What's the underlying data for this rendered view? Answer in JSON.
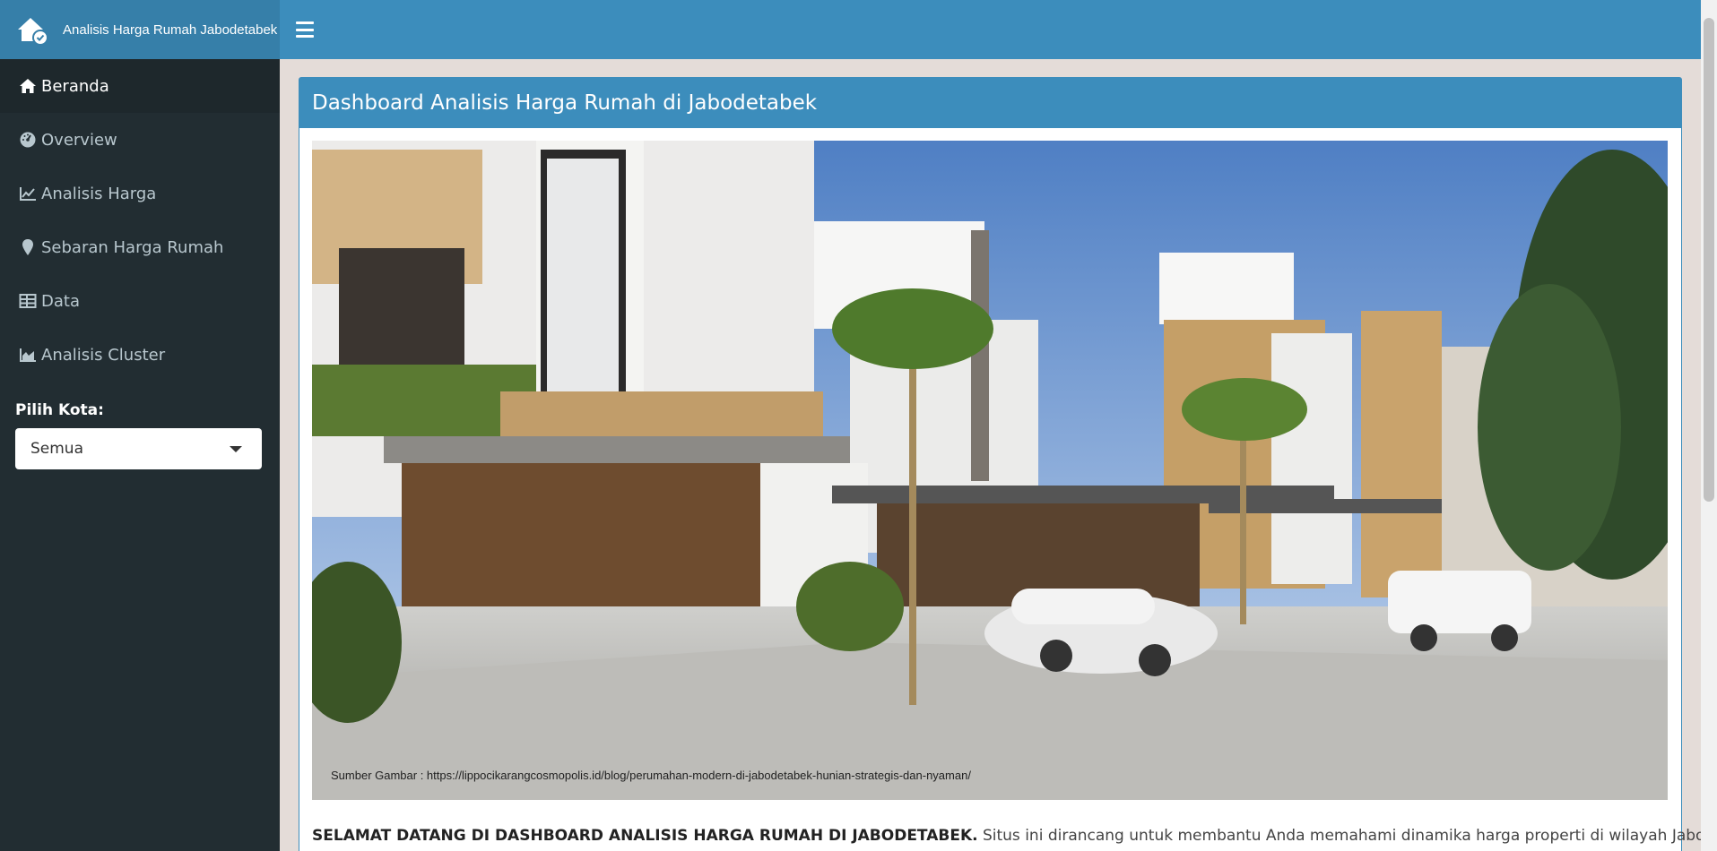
{
  "app": {
    "title": "Analisis Harga Rumah Jabodetabek"
  },
  "sidebar": {
    "items": [
      {
        "label": "Beranda",
        "icon": "home-icon"
      },
      {
        "label": "Overview",
        "icon": "dashboard-icon"
      },
      {
        "label": "Analisis Harga",
        "icon": "line-chart-icon"
      },
      {
        "label": "Sebaran Harga Rumah",
        "icon": "map-marker-icon"
      },
      {
        "label": "Data",
        "icon": "table-icon"
      },
      {
        "label": "Analisis Cluster",
        "icon": "area-chart-icon"
      }
    ],
    "city_filter": {
      "label": "Pilih Kota:",
      "selected": "Semua"
    }
  },
  "main": {
    "box_title": "Dashboard Analisis Harga Rumah di Jabodetabek",
    "image_caption": "Sumber Gambar : https://lippocikarangcosmopolis.id/blog/perumahan-modern-di-jabodetabek-hunian-strategis-dan-nyaman/",
    "welcome_bold": "SELAMAT DATANG DI DASHBOARD ANALISIS HARGA RUMAH DI JABODETABEK.",
    "welcome_text": " Situs ini dirancang untuk membantu Anda memahami dinamika harga properti di wilayah Jabodetabek,"
  },
  "colors": {
    "header": "#3c8dbc",
    "sidebar": "#222d32",
    "sidebar_active": "#1e282c"
  }
}
